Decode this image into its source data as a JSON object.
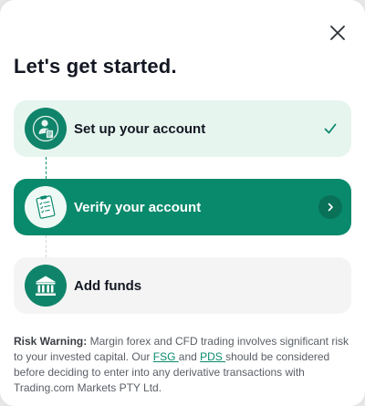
{
  "modal": {
    "title": "Let's get started.",
    "close_icon": "close-icon"
  },
  "steps": [
    {
      "label": "Set up your account",
      "status": "completed",
      "icon": "user-document-icon",
      "end_icon": "checkmark-icon"
    },
    {
      "label": "Verify your account",
      "status": "active",
      "icon": "clipboard-checklist-icon",
      "end_icon": "chevron-right-icon"
    },
    {
      "label": "Add funds",
      "status": "pending",
      "icon": "bank-building-icon"
    }
  ],
  "risk": {
    "heading": "Risk Warning:",
    "text1": " Margin forex and CFD trading involves significant risk to your invested capital. Our ",
    "link1": "FSG ",
    "text2": "and ",
    "link2": "PDS ",
    "text3": "should be considered before deciding to enter into any derivative transactions with Trading.com Markets PTY Ltd."
  },
  "colors": {
    "accent": "#0a8a6c",
    "completed_bg": "#e7f5ef",
    "pending_bg": "#f4f4f4"
  }
}
